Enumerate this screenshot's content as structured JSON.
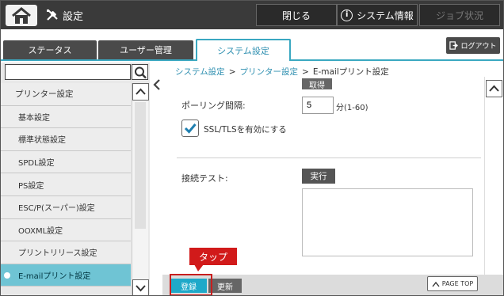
{
  "header": {
    "title": "設定",
    "close_label": "閉じる",
    "sysinfo_label": "システム情報",
    "job_label": "ジョブ状況",
    "info_glyph": "i"
  },
  "tabs": [
    {
      "label": "ステータス"
    },
    {
      "label": "ユーザー管理"
    },
    {
      "label": "システム設定"
    }
  ],
  "logout_label": "ログアウト",
  "search": {
    "value": ""
  },
  "sidebar": {
    "items": [
      {
        "label": "プリンター設定"
      },
      {
        "label": "基本設定"
      },
      {
        "label": "標準状態設定"
      },
      {
        "label": "SPDL設定"
      },
      {
        "label": "PS設定"
      },
      {
        "label": "ESC/P(スーパー)設定"
      },
      {
        "label": "OOXML設定"
      },
      {
        "label": "プリントリリース設定"
      },
      {
        "label": "E-mailプリント設定"
      }
    ]
  },
  "breadcrumb": {
    "level1": "システム設定",
    "level2": "プリンター設定",
    "level3": "E-mailプリント設定",
    "separator": ">"
  },
  "form": {
    "get_label": "取得",
    "polling_label": "ポーリング間隔:",
    "polling_value": "5",
    "polling_unit": "分(1-60)",
    "ssl_label": "SSL/TLSを有効にする",
    "ssl_checked": true,
    "conn_label": "接続テスト:",
    "run_label": "実行"
  },
  "footer": {
    "register_label": "登録",
    "update_label": "更新",
    "pagetop_label": "PAGE TOP"
  },
  "annotation": {
    "tap_label": "タップ"
  },
  "colors": {
    "accent": "#3aa8c1",
    "active_item": "#6fc4d4",
    "callout": "#d11a1a"
  }
}
